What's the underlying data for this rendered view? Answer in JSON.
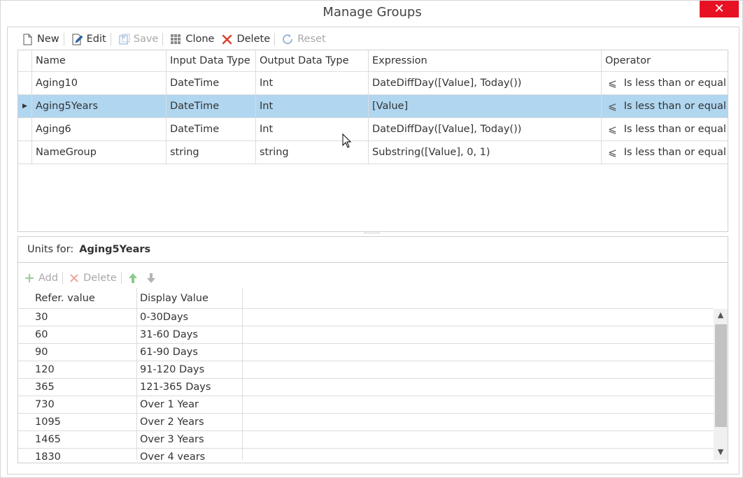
{
  "window": {
    "title": "Manage Groups",
    "close_label": "✕"
  },
  "toolbar": {
    "new_label": "New",
    "edit_label": "Edit",
    "save_label": "Save",
    "clone_label": "Clone",
    "delete_label": "Delete",
    "reset_label": "Reset"
  },
  "groups_grid": {
    "columns": [
      "Name",
      "Input Data Type",
      "Output Data Type",
      "Expression",
      "Operator"
    ],
    "rows": [
      {
        "name": "Aging10",
        "input": "DateTime",
        "output": "Int",
        "expression": "DateDiffDay([Value], Today())",
        "operator": "Is less than or equal to"
      },
      {
        "name": "Aging5Years",
        "input": "DateTime",
        "output": "Int",
        "expression": "[Value]",
        "operator": "Is less than or equal to"
      },
      {
        "name": "Aging6",
        "input": "DateTime",
        "output": "Int",
        "expression": "DateDiffDay([Value], Today())",
        "operator": "Is less than or equal to"
      },
      {
        "name": "NameGroup",
        "input": "string",
        "output": "string",
        "expression": "Substring([Value], 0, 1)",
        "operator": "Is less than or equal to"
      }
    ],
    "selected_row": "Aging5Years"
  },
  "units": {
    "label": "Units for:",
    "group_name": "Aging5Years",
    "add_label": "Add",
    "delete_label": "Delete",
    "columns": [
      "Refer. value",
      "Display Value"
    ],
    "rows": [
      {
        "ref": "30",
        "display": "0-30Days"
      },
      {
        "ref": "60",
        "display": "31-60 Days"
      },
      {
        "ref": "90",
        "display": "61-90 Days"
      },
      {
        "ref": "120",
        "display": "91-120 Days"
      },
      {
        "ref": "365",
        "display": "121-365 Days"
      },
      {
        "ref": "730",
        "display": "Over 1 Year"
      },
      {
        "ref": "1095",
        "display": "Over 2 Years"
      },
      {
        "ref": "1465",
        "display": "Over 3 Years"
      },
      {
        "ref": "1830",
        "display": "Over 4 years"
      }
    ]
  },
  "colors": {
    "close": "#e81123",
    "selection": "#b0d6f0",
    "delete_icon": "#d9412b",
    "arrow_up": "#5cb85c",
    "disabled": "#a8a8a8"
  }
}
